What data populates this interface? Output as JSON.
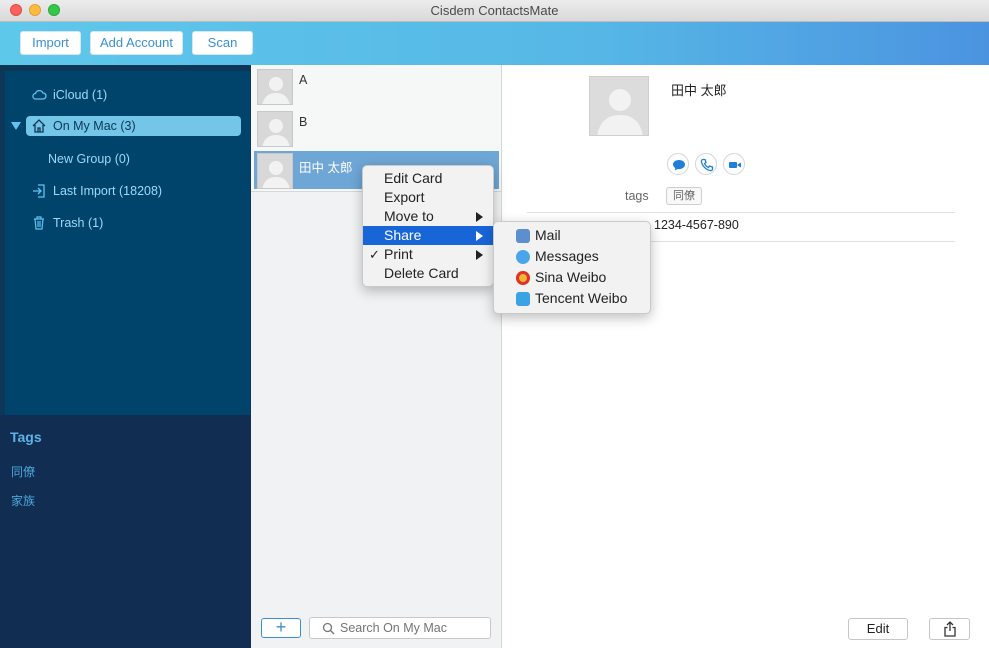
{
  "window": {
    "title": "Cisdem ContactsMate"
  },
  "toolbar": {
    "import_label": "Import",
    "add_account_label": "Add Account",
    "scan_label": "Scan"
  },
  "sidebar": {
    "icloud": "iCloud (1)",
    "on_my_mac": "On My Mac (3)",
    "new_group": "New Group (0)",
    "last_import": "Last Import (18208)",
    "trash": "Trash (1)",
    "tags_title": "Tags",
    "tags": [
      "同僚",
      "家族"
    ]
  },
  "contacts": [
    {
      "name": "A"
    },
    {
      "name": "B"
    },
    {
      "name": "田中 太郎"
    }
  ],
  "list_footer": {
    "add_label": "+",
    "search_placeholder": "Search On My Mac"
  },
  "detail": {
    "name": "田中 太郎",
    "tags_label": "tags",
    "tag_value": "同僚",
    "phone": "1234-4567-890",
    "edit_label": "Edit"
  },
  "context_menu": {
    "items": [
      "Edit Card",
      "Export",
      "Move to",
      "Share",
      "Print",
      "Delete Card"
    ],
    "check_mark": "✓"
  },
  "share_menu": {
    "items": [
      "Mail",
      "Messages",
      "Sina Weibo",
      "Tencent Weibo"
    ]
  },
  "colors": {
    "accent": "#3a8fd0",
    "menu_highlight": "#1865d8",
    "sidebar_bg": "#00446c",
    "tags_bg": "#112d52"
  }
}
